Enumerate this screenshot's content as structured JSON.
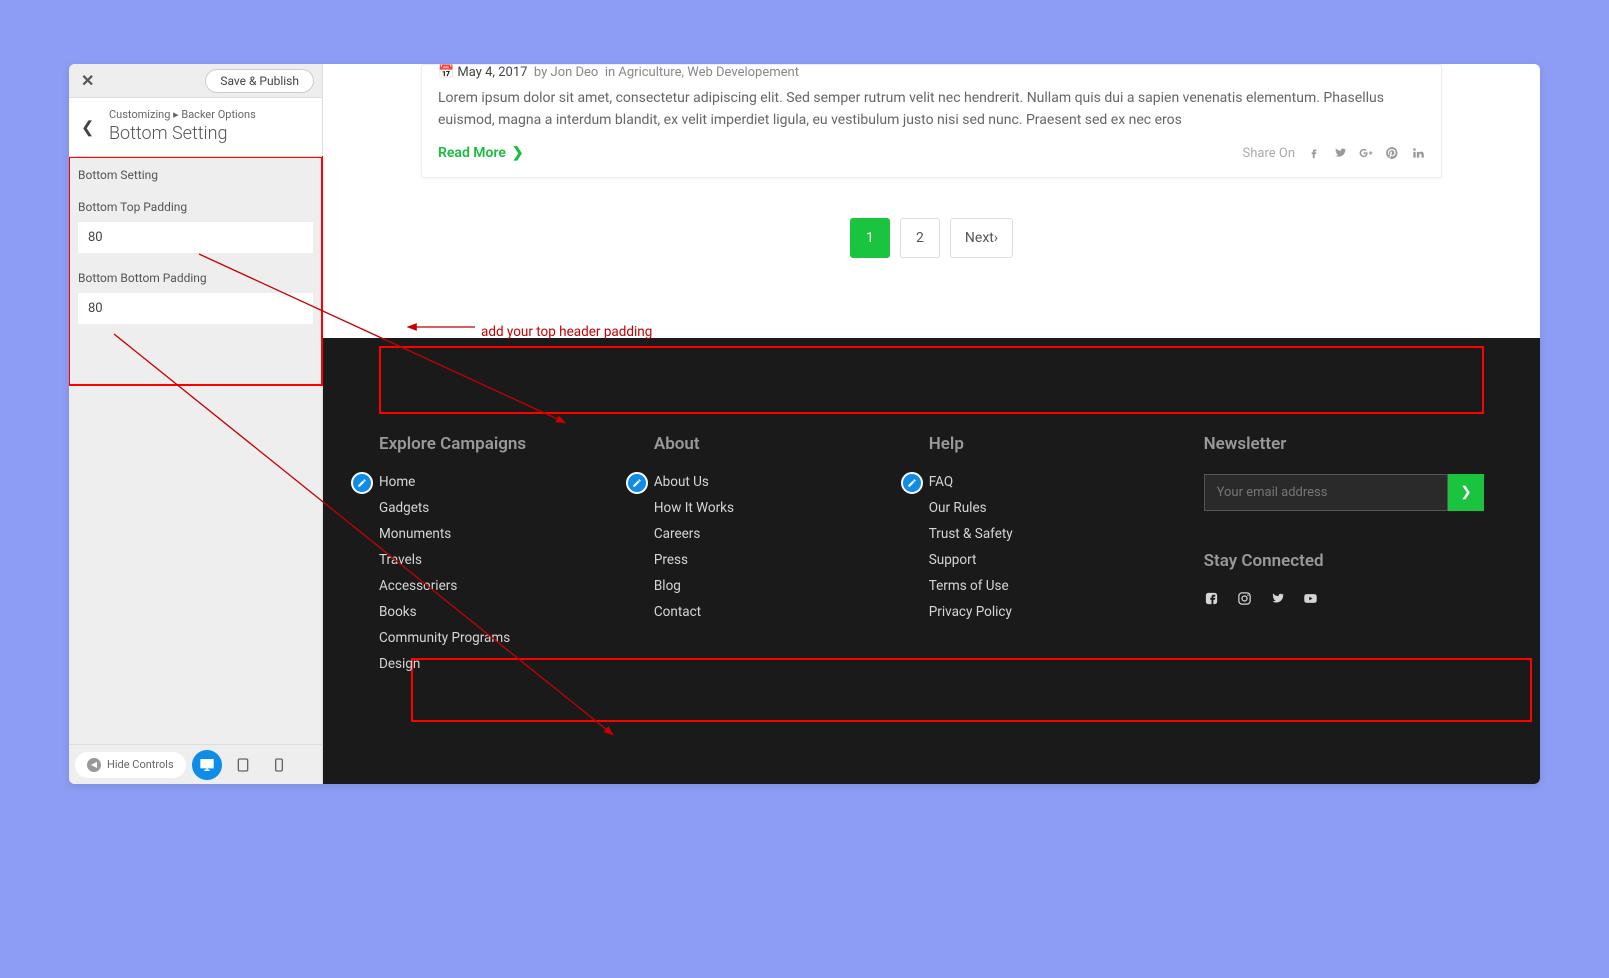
{
  "sidebar": {
    "save_label": "Save & Publish",
    "breadcrumb": "Customizing ▸ Backer Options",
    "section_title": "Bottom Setting",
    "panel_heading": "Bottom Setting",
    "field1_label": "Bottom Top Padding",
    "field1_value": "80",
    "field2_label": "Bottom Bottom Padding",
    "field2_value": "80",
    "hide_controls": "Hide Controls"
  },
  "annotation": {
    "text": "add your top header padding"
  },
  "article": {
    "date": "May 4, 2017",
    "by": "by",
    "author": "Jon Deo",
    "in": "in",
    "cat1": "Agriculture",
    "cat2": "Web Developement",
    "excerpt": "Lorem ipsum dolor sit amet, consectetur adipiscing elit. Sed semper rutrum velit nec hendrerit. Nullam quis dui a sapien venenatis elementum. Phasellus euismod, magna a interdum blandit, ex velit imperdiet ligula, eu vestibulum justo nisi sed nunc. Praesent sed ex nec eros",
    "read_more": "Read More",
    "share_on": "Share On"
  },
  "pager": {
    "p1": "1",
    "p2": "2",
    "next": "Next"
  },
  "footer": {
    "col1": {
      "h": "Explore Campaigns",
      "items": [
        "Home",
        "Gadgets",
        "Monuments",
        "Travels",
        "Accessoriers",
        "Books",
        "Community Programs",
        "Design"
      ]
    },
    "col2": {
      "h": "About",
      "items": [
        "About Us",
        "How It Works",
        "Careers",
        "Press",
        "Blog",
        "Contact"
      ]
    },
    "col3": {
      "h": "Help",
      "items": [
        "FAQ",
        "Our Rules",
        "Trust & Safety",
        "Support",
        "Terms of Use",
        "Privacy Policy"
      ]
    },
    "newsletter": {
      "h": "Newsletter",
      "placeholder": "Your email address",
      "stay_h": "Stay Connected"
    }
  }
}
